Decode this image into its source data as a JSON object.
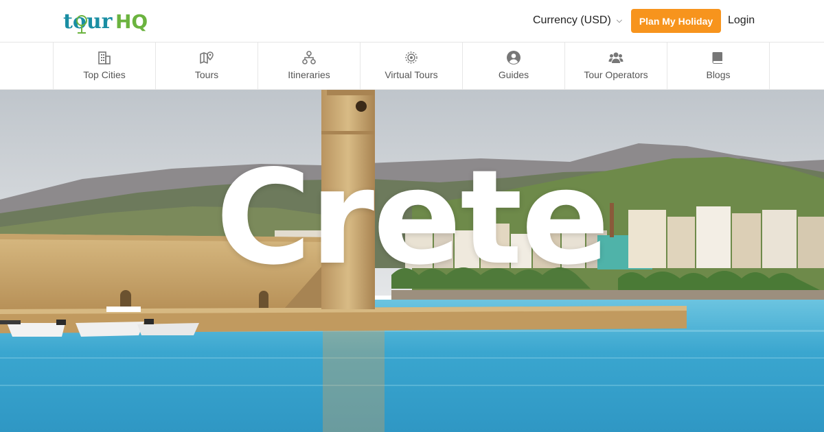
{
  "header": {
    "logo_text_1": "tour",
    "logo_text_2": "HQ",
    "currency_label": "Currency (USD)",
    "plan_button": "Plan My Holiday",
    "login": "Login"
  },
  "nav": {
    "items": [
      {
        "label": "Top Cities",
        "icon": "building-icon"
      },
      {
        "label": "Tours",
        "icon": "map-pin-icon"
      },
      {
        "label": "Itineraries",
        "icon": "sitemap-icon"
      },
      {
        "label": "Virtual Tours",
        "icon": "target-icon"
      },
      {
        "label": "Guides",
        "icon": "user-circle-icon"
      },
      {
        "label": "Tour Operators",
        "icon": "users-icon"
      },
      {
        "label": "Blogs",
        "icon": "book-icon"
      }
    ]
  },
  "hero": {
    "title": "Crete"
  },
  "colors": {
    "accent": "#f7941d",
    "logo_teal": "#1a8ea3",
    "logo_green": "#6bb33f",
    "sea": "#3aa6cf",
    "stone": "#c9a66b"
  }
}
